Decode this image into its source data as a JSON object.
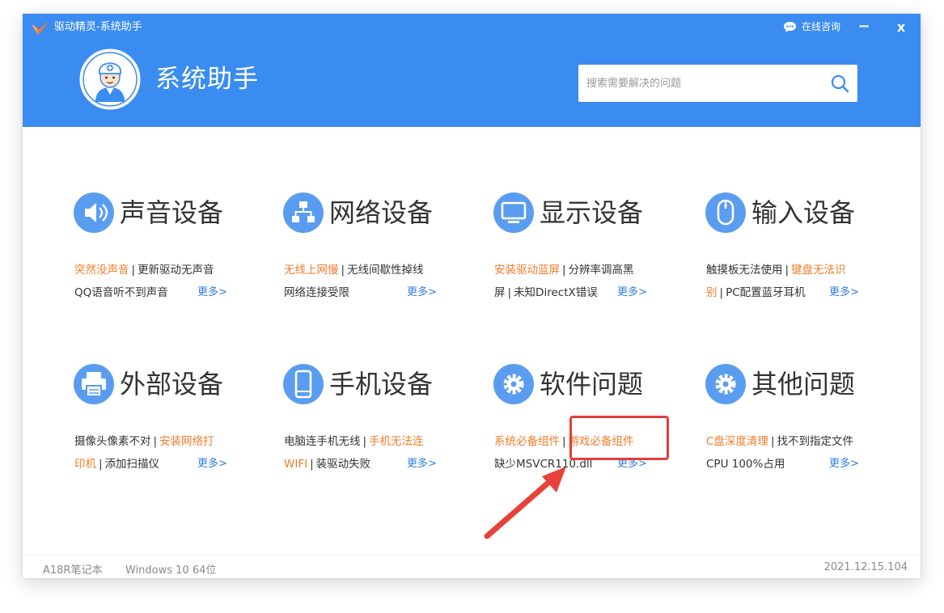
{
  "window": {
    "title": "驱动精灵-系统助手"
  },
  "titlebar": {
    "consult_label": "在线咨询",
    "minimize_label": "−",
    "close_label": "x"
  },
  "header": {
    "app_name": "系统助手"
  },
  "search": {
    "placeholder": "搜索需要解决的问题"
  },
  "colors": {
    "brand": "#3b8cf0",
    "icon_blue": "#5a9df0",
    "link_orange": "#f07c2c",
    "link_blue": "#2f7de1",
    "highlight_red": "#e33d3d"
  },
  "categories": [
    {
      "title": "声音设备",
      "icon": "speaker-icon",
      "line1": [
        {
          "t": "突然没声音",
          "hot": true
        },
        {
          "t": "更新驱动无声音",
          "hot": false
        }
      ],
      "line2": [
        {
          "t": "QQ语音听不到声音",
          "hot": false
        }
      ],
      "more": "更多>"
    },
    {
      "title": "网络设备",
      "icon": "network-icon",
      "line1": [
        {
          "t": "无线上网慢",
          "hot": true
        },
        {
          "t": "无线间歇性掉线",
          "hot": false
        }
      ],
      "line2": [
        {
          "t": "网络连接受限",
          "hot": false
        }
      ],
      "more": "更多>"
    },
    {
      "title": "显示设备",
      "icon": "monitor-icon",
      "line1": [
        {
          "t": "安装驱动蓝屏",
          "hot": true
        },
        {
          "t": "分辨率调高黑",
          "hot": false
        }
      ],
      "line2": [
        {
          "t": "屏",
          "hot": false
        },
        {
          "t": "未知DirectX错误",
          "hot": false
        }
      ],
      "more": "更多>"
    },
    {
      "title": "输入设备",
      "icon": "mouse-icon",
      "line1": [
        {
          "t": "触摸板无法使用",
          "hot": false
        },
        {
          "t": "键盘无法识",
          "hot": true
        }
      ],
      "line2": [
        {
          "t": "别",
          "hot": true
        },
        {
          "t": "PC配置蓝牙耳机",
          "hot": false
        }
      ],
      "more": "更多>"
    },
    {
      "title": "外部设备",
      "icon": "printer-icon",
      "line1": [
        {
          "t": "摄像头像素不对",
          "hot": false
        },
        {
          "t": "安装网络打",
          "hot": true
        }
      ],
      "line2": [
        {
          "t": "印机",
          "hot": true
        },
        {
          "t": "添加扫描仪",
          "hot": false
        }
      ],
      "more": "更多>"
    },
    {
      "title": "手机设备",
      "icon": "phone-icon",
      "line1": [
        {
          "t": "电脑连手机无线",
          "hot": false
        },
        {
          "t": "手机无法连",
          "hot": true
        }
      ],
      "line2": [
        {
          "t": "WIFI",
          "hot": true
        },
        {
          "t": "装驱动失败",
          "hot": false
        }
      ],
      "more": "更多>"
    },
    {
      "title": "软件问题",
      "icon": "gear-icon",
      "line1": [
        {
          "t": "系统必备组件",
          "hot": true
        },
        {
          "t": "游戏必备组件",
          "hot": true
        }
      ],
      "line2": [
        {
          "t": "缺少MSVCR110.dll",
          "hot": false
        }
      ],
      "more": "更多>"
    },
    {
      "title": "其他问题",
      "icon": "gear-icon",
      "line1": [
        {
          "t": "C盘深度清理",
          "hot": true
        },
        {
          "t": "找不到指定文件",
          "hot": false
        }
      ],
      "line2": [
        {
          "t": "CPU 100%占用",
          "hot": false
        }
      ],
      "more": "更多>"
    }
  ],
  "footer": {
    "model": "A18R笔记本",
    "os": "Windows 10 64位",
    "version": "2021.12.15.104"
  }
}
